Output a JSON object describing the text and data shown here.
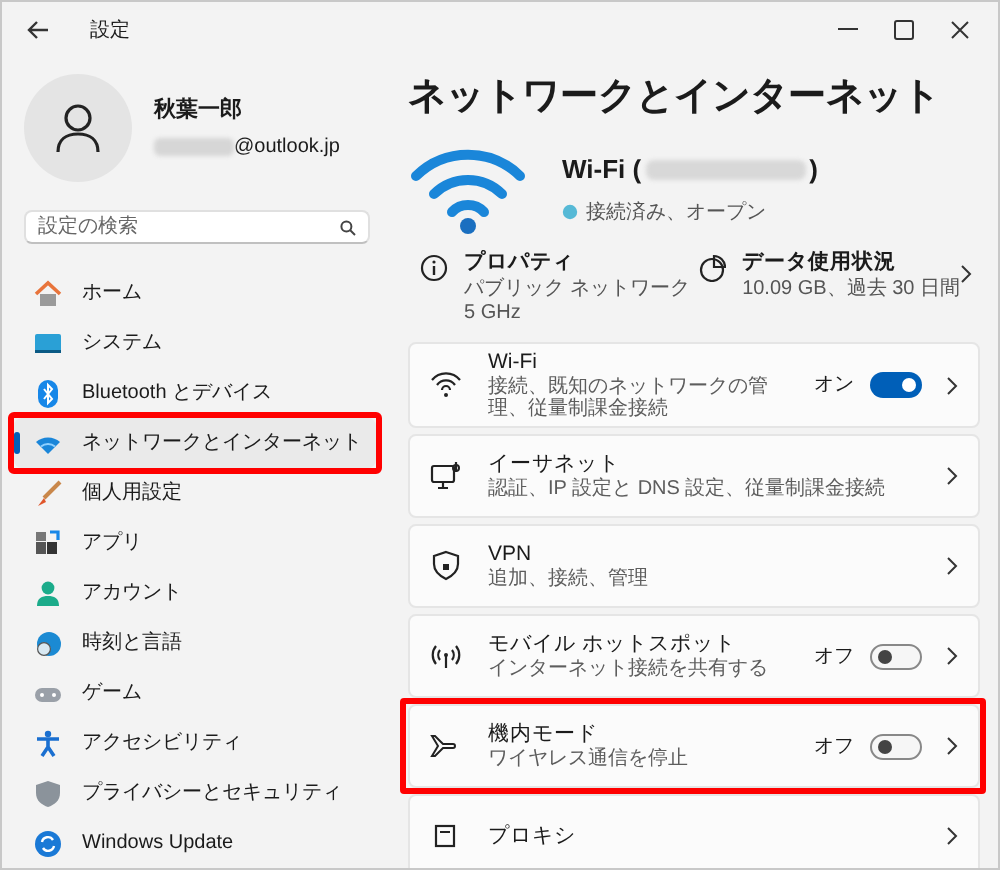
{
  "window": {
    "title": "設定"
  },
  "profile": {
    "name": "秋葉一郎",
    "email_domain": "@outlook.jp"
  },
  "search": {
    "placeholder": "設定の検索"
  },
  "nav": [
    {
      "label": "ホーム",
      "selected": false,
      "highlighted": false
    },
    {
      "label": "システム",
      "selected": false,
      "highlighted": false
    },
    {
      "label": "Bluetooth とデバイス",
      "selected": false,
      "highlighted": false
    },
    {
      "label": "ネットワークとインターネット",
      "selected": true,
      "highlighted": true
    },
    {
      "label": "個人用設定",
      "selected": false,
      "highlighted": false
    },
    {
      "label": "アプリ",
      "selected": false,
      "highlighted": false
    },
    {
      "label": "アカウント",
      "selected": false,
      "highlighted": false
    },
    {
      "label": "時刻と言語",
      "selected": false,
      "highlighted": false
    },
    {
      "label": "ゲーム",
      "selected": false,
      "highlighted": false
    },
    {
      "label": "アクセシビリティ",
      "selected": false,
      "highlighted": false
    },
    {
      "label": "プライバシーとセキュリティ",
      "selected": false,
      "highlighted": false
    },
    {
      "label": "Windows Update",
      "selected": false,
      "highlighted": false
    }
  ],
  "page_title": "ネットワークとインターネット",
  "connection": {
    "name_prefix": "Wi-Fi (",
    "name_suffix": ")",
    "status": "接続済み、オープン"
  },
  "summary": [
    {
      "kind": "properties",
      "title": "プロパティ",
      "lines": [
        "パブリック ネットワーク",
        "5 GHz"
      ]
    },
    {
      "kind": "data_usage",
      "title": "データ使用状況",
      "lines": [
        "10.09 GB、過去 30 日間"
      ]
    }
  ],
  "settings": [
    {
      "title": "Wi-Fi",
      "subtitle": "接続、既知のネットワークの管理、従量制課金接続",
      "toggle": {
        "label": "オン",
        "on": true
      },
      "highlighted": false
    },
    {
      "title": "イーサネット",
      "subtitle": "認証、IP 設定と DNS 設定、従量制課金接続",
      "highlighted": false
    },
    {
      "title": "VPN",
      "subtitle": "追加、接続、管理",
      "highlighted": false
    },
    {
      "title": "モバイル ホットスポット",
      "subtitle": "インターネット接続を共有する",
      "toggle": {
        "label": "オフ",
        "on": false
      },
      "highlighted": false
    },
    {
      "title": "機内モード",
      "subtitle": "ワイヤレス通信を停止",
      "toggle": {
        "label": "オフ",
        "on": false
      },
      "highlighted": true
    },
    {
      "title": "プロキシ",
      "highlighted": false
    }
  ]
}
